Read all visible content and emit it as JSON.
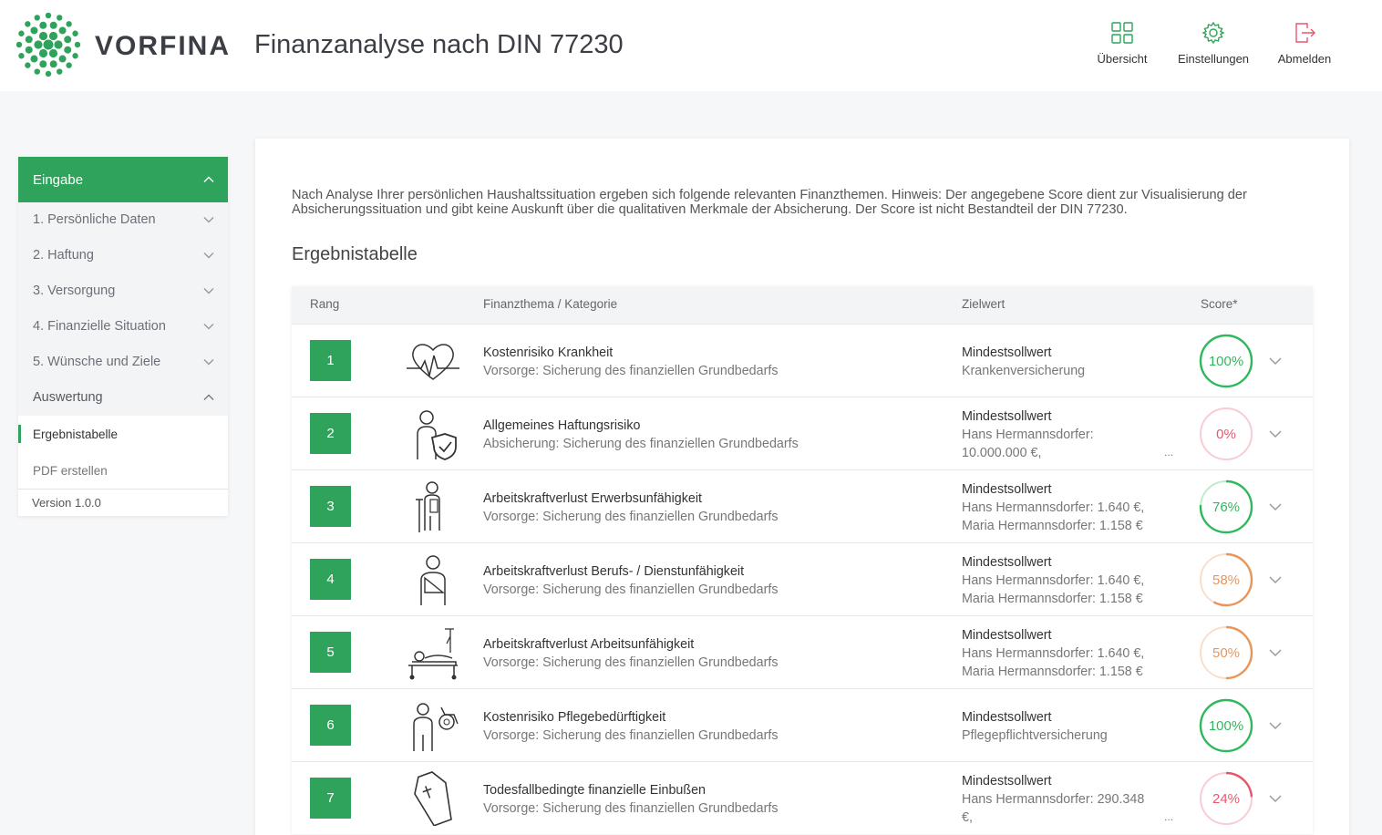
{
  "header": {
    "brand": "VORFINA",
    "title": "Finanzanalyse nach DIN 77230",
    "nav": [
      {
        "label": "Übersicht",
        "icon": "grid-icon"
      },
      {
        "label": "Einstellungen",
        "icon": "gear-icon"
      },
      {
        "label": "Abmelden",
        "icon": "logout-icon"
      }
    ],
    "accent": "#2fa35b"
  },
  "sidebar": {
    "head": "Eingabe",
    "items": [
      "1. Persönliche Daten",
      "2. Haftung",
      "3. Versorgung",
      "4. Finanzielle Situation",
      "5. Wünsche und Ziele"
    ],
    "section": "Auswertung",
    "sub": [
      "Ergebnistabelle",
      "PDF erstellen"
    ],
    "version": "Version 1.0.0"
  },
  "main": {
    "intro": "Nach Analyse Ihrer persönlichen Haushaltssituation ergeben sich folgende relevanten Finanzthemen. Hinweis: Der angegebene Score dient zur Visualisierung der Absicherungssituation und gibt keine Auskunft über die qualitativen Merkmale der Absicherung. Der Score ist nicht Bestandteil der DIN 77230.",
    "section_title": "Ergebnistabelle",
    "columns": {
      "rank": "Rang",
      "theme": "Finanzthema / Kategorie",
      "target": "Zielwert",
      "score": "Score*"
    },
    "rows": [
      {
        "rank": "1",
        "icon": "heart-pulse-icon",
        "title": "Kostenrisiko Krankheit",
        "category": "Vorsorge: Sicherung des finanziellen Grundbedarfs",
        "target_label": "Mindestsollwert",
        "target_lines": [
          "Krankenversicherung"
        ],
        "more": "",
        "score": 1.0,
        "score_label": "100%",
        "color": "#2fb85c"
      },
      {
        "rank": "2",
        "icon": "person-shield-icon",
        "title": "Allgemeines Haftungsrisiko",
        "category": "Absicherung: Sicherung des finanziellen Grundbedarfs",
        "target_label": "Mindestsollwert",
        "target_lines": [
          "Hans Hermannsdorfer:",
          "10.000.000 €,"
        ],
        "more": "...",
        "score": 0.0,
        "score_label": "0%",
        "color": "#e8566c"
      },
      {
        "rank": "3",
        "icon": "person-crutch-icon",
        "title": "Arbeitskraftverlust Erwerbsunfähigkeit",
        "category": "Vorsorge: Sicherung des finanziellen Grundbedarfs",
        "target_label": "Mindestsollwert",
        "target_lines": [
          "Hans Hermannsdorfer: 1.640 €,",
          "Maria Hermannsdorfer: 1.158 €"
        ],
        "more": "",
        "score": 0.76,
        "score_label": "76%",
        "color": "#2fb85c"
      },
      {
        "rank": "4",
        "icon": "person-sling-icon",
        "title": "Arbeitskraftverlust Berufs- / Dienstunfähigkeit",
        "category": "Vorsorge: Sicherung des finanziellen Grundbedarfs",
        "target_label": "Mindestsollwert",
        "target_lines": [
          "Hans Hermannsdorfer: 1.640 €,",
          "Maria Hermannsdorfer: 1.158 €"
        ],
        "more": "",
        "score": 0.58,
        "score_label": "58%",
        "color": "#e8955a"
      },
      {
        "rank": "5",
        "icon": "hospital-bed-icon",
        "title": "Arbeitskraftverlust Arbeitsunfähigkeit",
        "category": "Vorsorge: Sicherung des finanziellen Grundbedarfs",
        "target_label": "Mindestsollwert",
        "target_lines": [
          "Hans Hermannsdorfer: 1.640 €,",
          "Maria Hermannsdorfer: 1.158 €"
        ],
        "more": "",
        "score": 0.5,
        "score_label": "50%",
        "color": "#e8955a"
      },
      {
        "rank": "6",
        "icon": "person-wheelchair-icon",
        "title": "Kostenrisiko Pflegebedürftigkeit",
        "category": "Vorsorge: Sicherung des finanziellen Grundbedarfs",
        "target_label": "Mindestsollwert",
        "target_lines": [
          "Pflegepflichtversicherung"
        ],
        "more": "",
        "score": 1.0,
        "score_label": "100%",
        "color": "#2fb85c"
      },
      {
        "rank": "7",
        "icon": "coffin-icon",
        "title": "Todesfallbedingte finanzielle Einbußen",
        "category": "Vorsorge: Sicherung des finanziellen Grundbedarfs",
        "target_label": "Mindestsollwert",
        "target_lines": [
          "Hans Hermannsdorfer: 290.348",
          "€,"
        ],
        "more": "...",
        "score": 0.24,
        "score_label": "24%",
        "color": "#e8566c"
      }
    ]
  }
}
